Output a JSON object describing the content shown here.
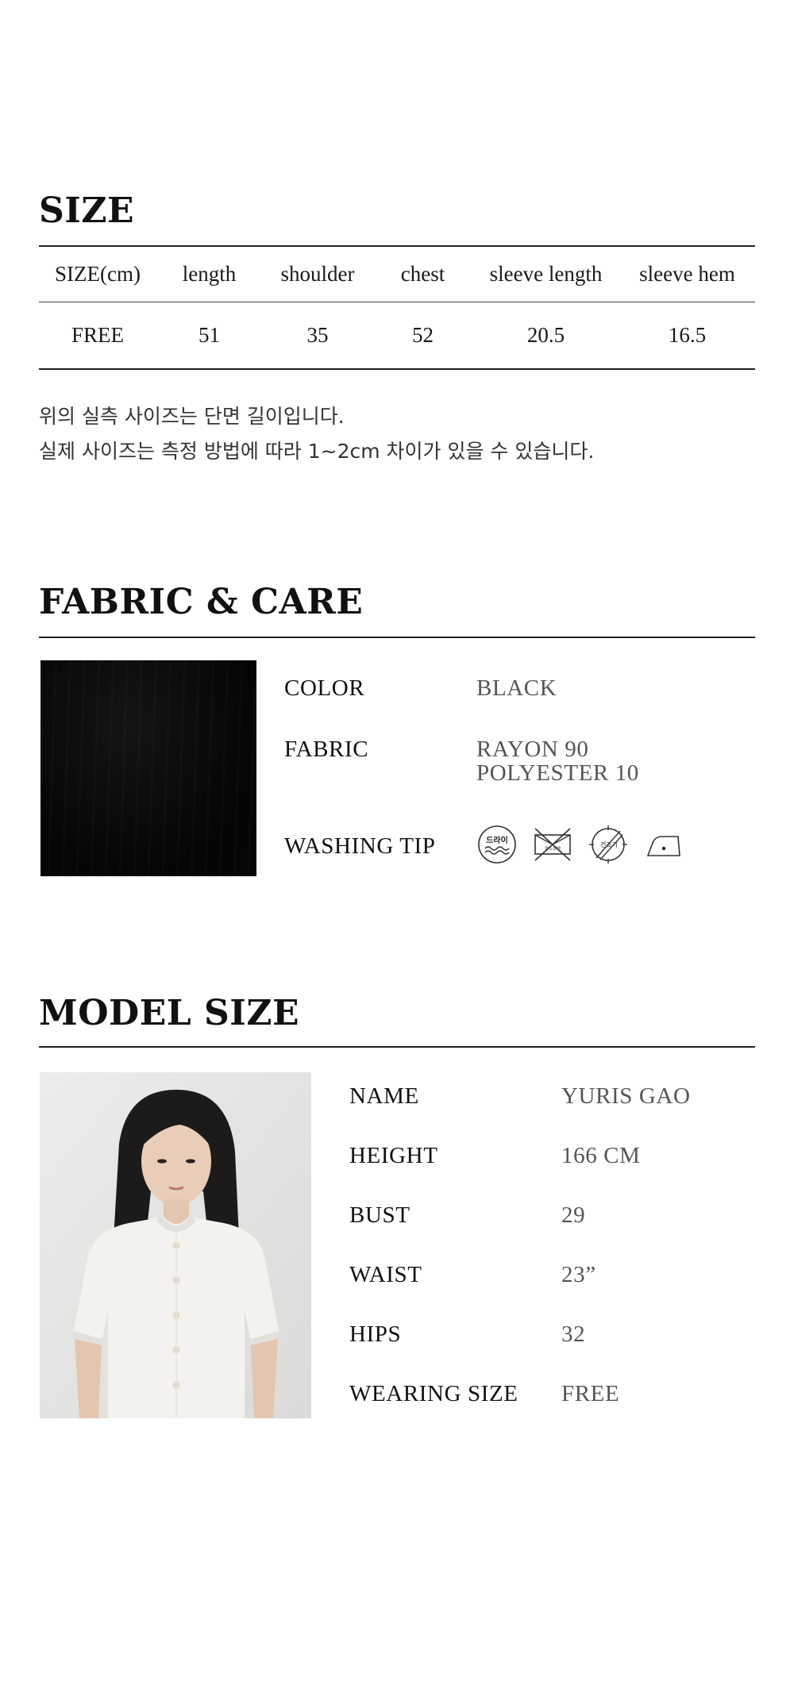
{
  "size": {
    "title": "SIZE",
    "headers": [
      "SIZE(cm)",
      "length",
      "shoulder",
      "chest",
      "sleeve length",
      "sleeve hem"
    ],
    "row": [
      "FREE",
      "51",
      "35",
      "52",
      "20.5",
      "16.5"
    ],
    "note_line1": "위의 실측 사이즈는 단면 길이입니다.",
    "note_line2": "실제 사이즈는 측정 방법에 따라 1~2cm 차이가 있을 수 있습니다."
  },
  "fabric": {
    "title": "FABRIC & CARE",
    "color_label": "COLOR",
    "color_value": "BLACK",
    "fabric_label": "FABRIC",
    "fabric_value_1": "RAYON 90",
    "fabric_value_2": "POLYESTER 10",
    "washing_label": "WASHING TIP",
    "icon_dry_text": "드라이",
    "icon_bleach_text": "염소표백",
    "icon_dryer_text": "건조기",
    "icons": [
      "dry-clean-icon",
      "no-hand-wash-icon",
      "no-tumble-dry-icon",
      "low-iron-icon"
    ]
  },
  "model": {
    "title": "MODEL SIZE",
    "rows": [
      {
        "label": "NAME",
        "value": "YURIS GAO"
      },
      {
        "label": "HEIGHT",
        "value": "166 CM"
      },
      {
        "label": "BUST",
        "value": "29"
      },
      {
        "label": "WAIST",
        "value": "23”"
      },
      {
        "label": "HIPS",
        "value": "32"
      },
      {
        "label": "WEARING SIZE",
        "value": "FREE"
      }
    ]
  }
}
